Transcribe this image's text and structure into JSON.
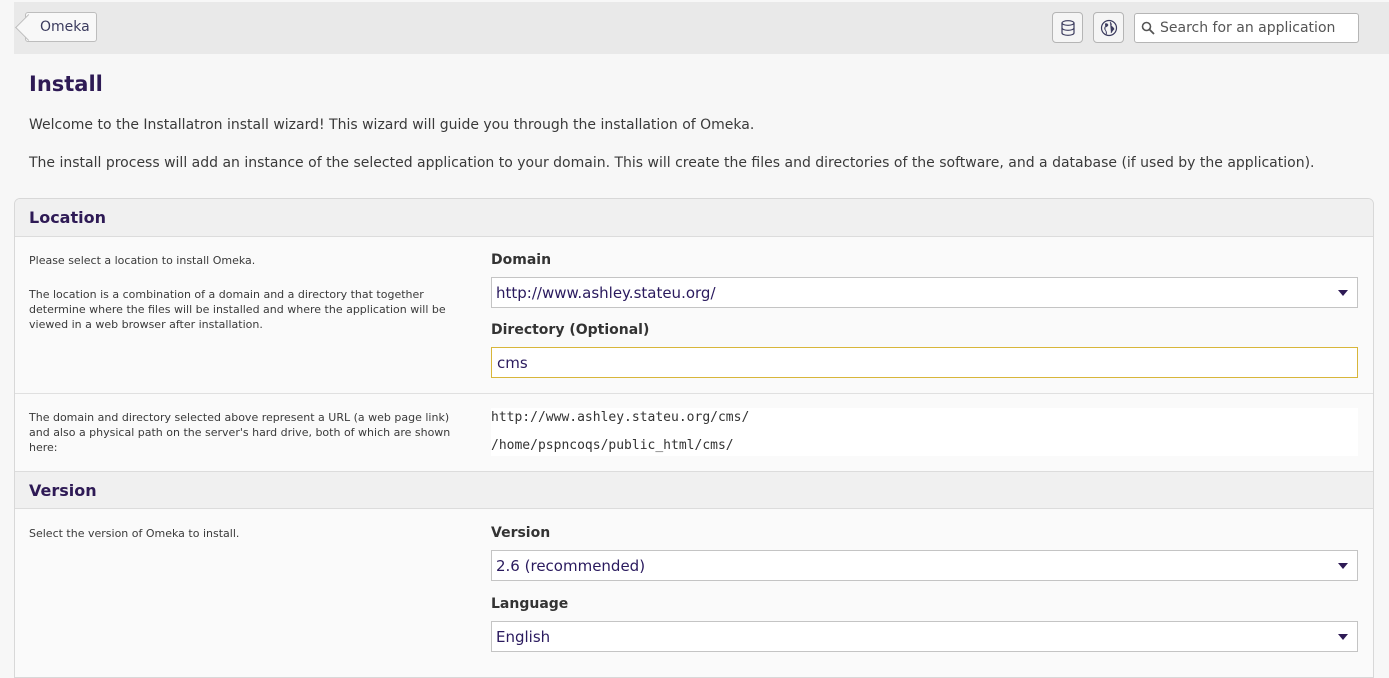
{
  "header": {
    "back_label": "Omeka",
    "database_icon": "database-icon",
    "globe_icon": "globe-icon",
    "search_placeholder": "Search for an application"
  },
  "page": {
    "title": "Install",
    "intro_1": "Welcome to the Installatron install wizard! This wizard will guide you through the installation of Omeka.",
    "intro_2": "The install process will add an instance of the selected application to your domain. This will create the files and directories of the software, and a database (if used by the application)."
  },
  "location": {
    "heading": "Location",
    "help_1": "Please select a location to install Omeka.",
    "help_2": "The location is a combination of a domain and a directory that together determine where the files will be installed and where the application will be viewed in a web browser after installation.",
    "domain_label": "Domain",
    "domain_value": "http://www.ashley.stateu.org/",
    "directory_label": "Directory (Optional)",
    "directory_value": "cms",
    "paths_help": "The domain and directory selected above represent a URL (a web page link) and also a physical path on the server's hard drive, both of which are shown here:",
    "url_path": "http://www.ashley.stateu.org/cms/",
    "disk_path": "/home/pspncoqs/public_html/cms/"
  },
  "version": {
    "heading": "Version",
    "help": "Select the version of Omeka to install.",
    "version_label": "Version",
    "version_value": "2.6 (recommended)",
    "language_label": "Language",
    "language_value": "English"
  },
  "colors": {
    "heading": "#2e1a55",
    "focus_border": "#d8b63a",
    "topbar": "#e9e9e9"
  }
}
